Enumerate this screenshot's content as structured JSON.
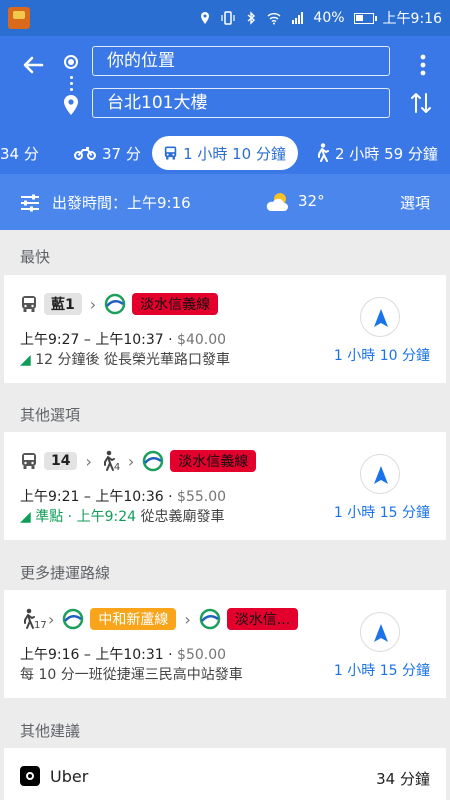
{
  "status_bar": {
    "battery": "40%",
    "time": "上午9:16"
  },
  "header": {
    "origin": "你的位置",
    "destination": "台北101大樓",
    "modes": [
      {
        "label": "34 分"
      },
      {
        "label": "37 分"
      },
      {
        "label": "1 小時 10 分鐘"
      },
      {
        "label": "2 小時 59 分鐘"
      }
    ]
  },
  "time_bar": {
    "depart": "出發時間：上午9:16",
    "temperature": "32°",
    "options": "選項"
  },
  "sections": {
    "fastest": "最快",
    "other": "其他選項",
    "more_mrt": "更多捷運路線",
    "suggestions": "其他建議"
  },
  "routes": [
    {
      "bus": "藍1",
      "line": "淡水信義線",
      "times": "上午9:27 – 上午10:37",
      "fare": "$40.00",
      "note": "12 分鐘後 從長榮光華路口發車",
      "duration": "1 小時 10 分鐘"
    },
    {
      "bus": "14",
      "walk": "4",
      "line": "淡水信義線",
      "times": "上午9:21 – 上午10:36",
      "fare": "$55.00",
      "note_live": "準點 · 上午9:24",
      "note": "從忠義廟發車",
      "duration": "1 小時 15 分鐘"
    },
    {
      "walk": "17",
      "line1": "中和新蘆線",
      "line2": "淡水信...",
      "times": "上午9:16 – 上午10:31",
      "fare": "$50.00",
      "note": "每 10 分一班從捷運三民高中站發車",
      "duration": "1 小時 15 分鐘"
    }
  ],
  "uber": {
    "label": "Uber",
    "time": "34 分鐘"
  },
  "colors": {
    "header": "#3b78e7",
    "time_bar": "#4a86ec",
    "accent": "#1a73e8",
    "line_red": "#e3002c",
    "line_orange": "#f8a51b",
    "live": "#0f9d58"
  }
}
